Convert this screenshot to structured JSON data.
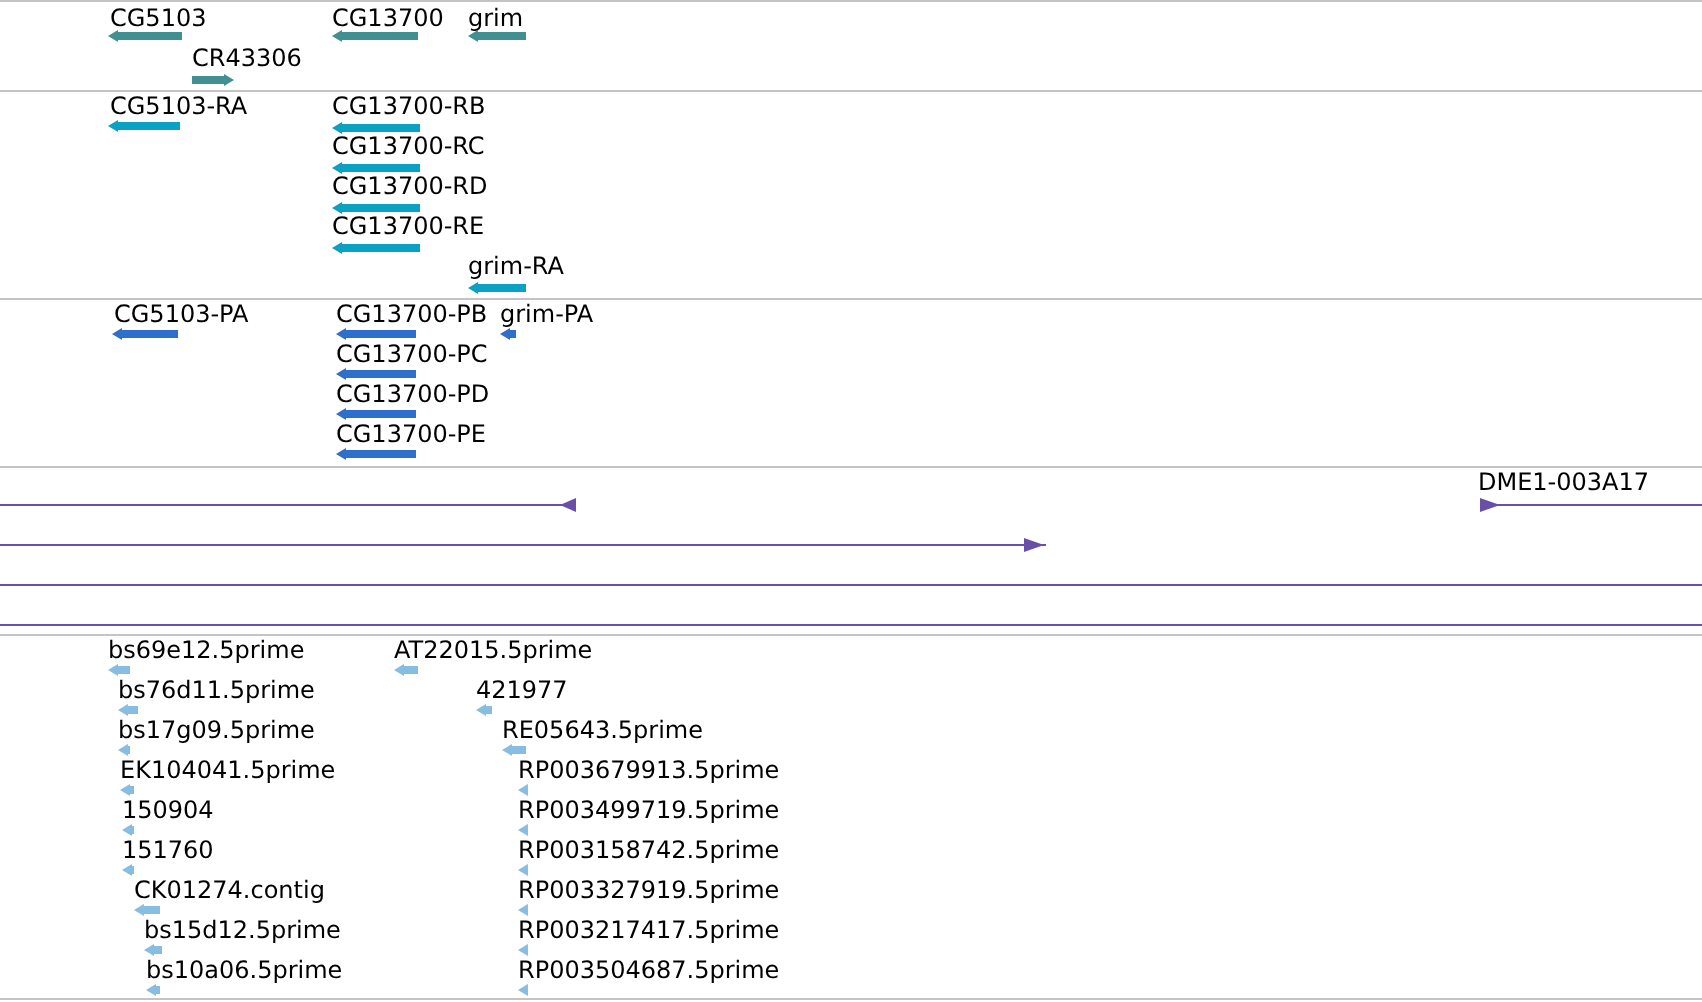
{
  "tracks": [
    {
      "kind": "block",
      "color": "#3f8f93",
      "features": [
        {
          "label": "CG5103",
          "kind": "reverse"
        },
        {
          "label": "CG13700",
          "kind": "reverse"
        },
        {
          "label": "grim",
          "kind": "reverse"
        },
        {
          "label": "CR43306",
          "kind": "forward"
        }
      ]
    },
    {
      "kind": "block",
      "color": "#0aa2c4",
      "features": [
        {
          "label": "CG5103-RA",
          "kind": "reverse"
        },
        {
          "label": "CG13700-RB",
          "kind": "reverse"
        },
        {
          "label": "CG13700-RC",
          "kind": "reverse"
        },
        {
          "label": "CG13700-RD",
          "kind": "reverse"
        },
        {
          "label": "CG13700-RE",
          "kind": "reverse"
        },
        {
          "label": "grim-RA",
          "kind": "reverse"
        }
      ]
    },
    {
      "kind": "block",
      "color": "#2f6fcc",
      "features": [
        {
          "label": "CG5103-PA",
          "kind": "reverse"
        },
        {
          "label": "CG13700-PB",
          "kind": "reverse"
        },
        {
          "label": "CG13700-PC",
          "kind": "reverse"
        },
        {
          "label": "CG13700-PD",
          "kind": "reverse"
        },
        {
          "label": "CG13700-PE",
          "kind": "reverse"
        },
        {
          "label": "grim-PA",
          "kind": "reverse"
        }
      ]
    },
    {
      "kind": "line",
      "color": "#6a4fa8",
      "features": [
        {
          "kind": "reverse"
        },
        {
          "label": "DME1-003A17",
          "kind": "forward"
        },
        {
          "kind": "forward"
        },
        {
          "kind": "unheaded"
        },
        {
          "kind": "unheaded"
        }
      ]
    },
    {
      "kind": "block",
      "color": "#86bde0",
      "features": [
        {
          "label": "bs69e12.5prime",
          "kind": "reverse"
        },
        {
          "label": "bs76d11.5prime",
          "kind": "reverse"
        },
        {
          "label": "bs17g09.5prime",
          "kind": "reverse"
        },
        {
          "label": "EK104041.5prime",
          "kind": "reverse"
        },
        {
          "label": "150904",
          "kind": "reverse"
        },
        {
          "label": "151760",
          "kind": "reverse"
        },
        {
          "label": "CK01274.contig",
          "kind": "reverse"
        },
        {
          "label": "bs15d12.5prime",
          "kind": "reverse"
        },
        {
          "label": "bs10a06.5prime",
          "kind": "reverse"
        },
        {
          "label": "AT22015.5prime",
          "kind": "reverse"
        },
        {
          "label": "421977",
          "kind": "reverse"
        },
        {
          "label": "RE05643.5prime",
          "kind": "reverse"
        },
        {
          "label": "RP003679913.5prime",
          "kind": "reverse"
        },
        {
          "label": "RP003499719.5prime",
          "kind": "reverse"
        },
        {
          "label": "RP003158742.5prime",
          "kind": "reverse"
        },
        {
          "label": "RP003327919.5prime",
          "kind": "reverse"
        },
        {
          "label": "RP003217417.5prime",
          "kind": "reverse"
        },
        {
          "label": "RP003504687.5prime",
          "kind": "reverse"
        }
      ]
    }
  ]
}
